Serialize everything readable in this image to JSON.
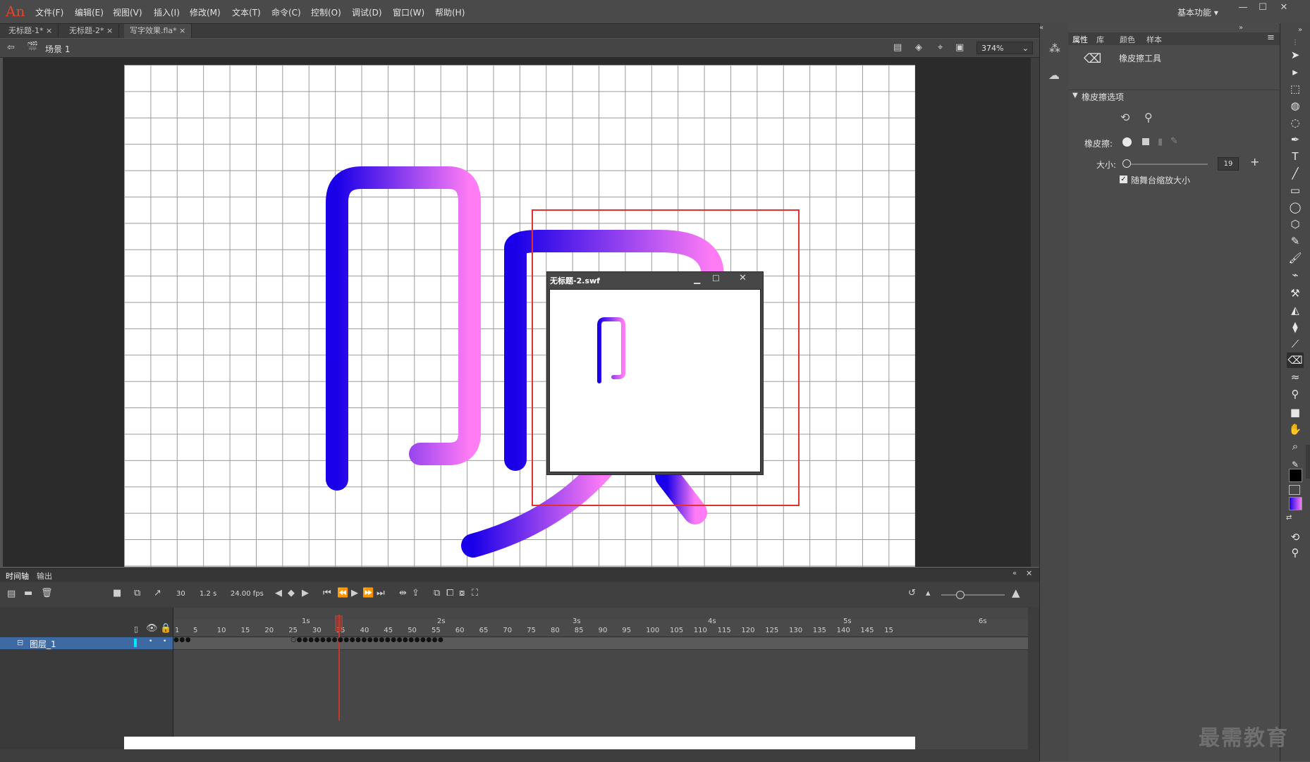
{
  "app": {
    "logo": "An",
    "workspace": "基本功能"
  },
  "menu": [
    "文件(F)",
    "编辑(E)",
    "视图(V)",
    "插入(I)",
    "修改(M)",
    "文本(T)",
    "命令(C)",
    "控制(O)",
    "调试(D)",
    "窗口(W)",
    "帮助(H)"
  ],
  "tabs": [
    "无标题-1*",
    "无标题-2*",
    "写字效果.fla*"
  ],
  "scene": {
    "label": "场景 1",
    "zoom": "374%"
  },
  "swf": {
    "title": "无标题-2.swf"
  },
  "timeline": {
    "tabs": [
      "时间轴",
      "输出"
    ],
    "frame": "30",
    "time": "1.2 s",
    "fps": "24.00 fps",
    "layer": "图层_1",
    "seconds": [
      "1s",
      "2s",
      "3s",
      "4s",
      "5s",
      "6s"
    ],
    "ruler": [
      "1",
      "5",
      "10",
      "15",
      "20",
      "25",
      "30",
      "35",
      "40",
      "45",
      "50",
      "55",
      "60",
      "65",
      "70",
      "75",
      "80",
      "85",
      "90",
      "95",
      "100",
      "105",
      "110",
      "115",
      "120",
      "125",
      "130",
      "135",
      "140",
      "145",
      "15"
    ]
  },
  "props": {
    "tabs": [
      "属性",
      "库",
      "颜色",
      "样本"
    ],
    "tool_name": "橡皮擦工具",
    "section": "橡皮擦选项",
    "eraser_label": "橡皮擦:",
    "size_label": "大小:",
    "size_value": "19",
    "scale_checkbox": "随舞台缩放大小",
    "scale_checked": true
  },
  "watermark": "最需教育",
  "colors": {
    "gradient_start": "#1a00e8",
    "gradient_end": "#ff7cf5",
    "accent_red": "#e23030"
  }
}
